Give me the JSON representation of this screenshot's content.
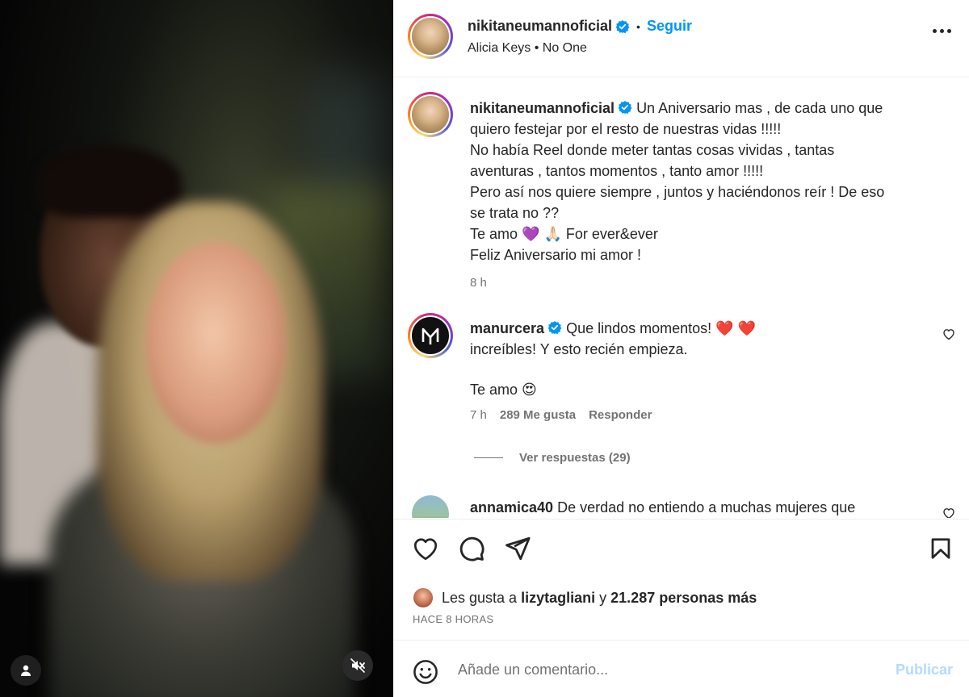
{
  "post": {
    "username": "nikitaneumannoficial",
    "follow_label": "Seguir",
    "separator": "•",
    "song_artist": "Alicia Keys",
    "song_title": "No One"
  },
  "caption": {
    "username": "nikitaneumannoficial",
    "lines": [
      "Un Aniversario mas , de cada uno que",
      "quiero festejar por el resto de nuestras vidas !!!!!",
      "No había Reel donde meter tantas cosas vividas , tantas",
      "aventuras , tantos momentos , tanto amor !!!!!",
      "Pero así nos quiere siempre , juntos y haciéndonos reír ! De eso",
      "se trata no ??",
      "Te amo 💜 🙏🏻 For ever&ever",
      "Feliz Aniversario mi amor !"
    ],
    "time": "8 h"
  },
  "comments": [
    {
      "username": "manurcera",
      "line1": "Que lindos momentos! ❤️ ❤️",
      "line2": "increíbles! Y esto recién empieza.",
      "line3": "Te amo 😍",
      "time": "7 h",
      "likes": "289 Me gusta",
      "reply_label": "Responder",
      "view_replies": "Ver respuestas (29)"
    },
    {
      "username": "annamica40",
      "text": "De verdad no entiendo a muchas mujeres que"
    }
  ],
  "likes": {
    "prefix": "Les gusta a",
    "user": "lizytagliani",
    "connector": "y",
    "others": "21.287 personas más"
  },
  "posted_ago": "HACE 8 HORAS",
  "comment_box": {
    "placeholder": "Añade un comentario...",
    "publish_label": "Publicar"
  },
  "colors": {
    "accent": "#0095f6",
    "verified": "#0095f6",
    "muted_text": "#737373",
    "publish_disabled": "#b3dbff"
  },
  "icons": [
    "user-icon",
    "muted-speaker-icon",
    "verified-icon",
    "more-icon",
    "heart-icon",
    "comment-icon",
    "share-icon",
    "bookmark-icon",
    "emoji-icon"
  ]
}
